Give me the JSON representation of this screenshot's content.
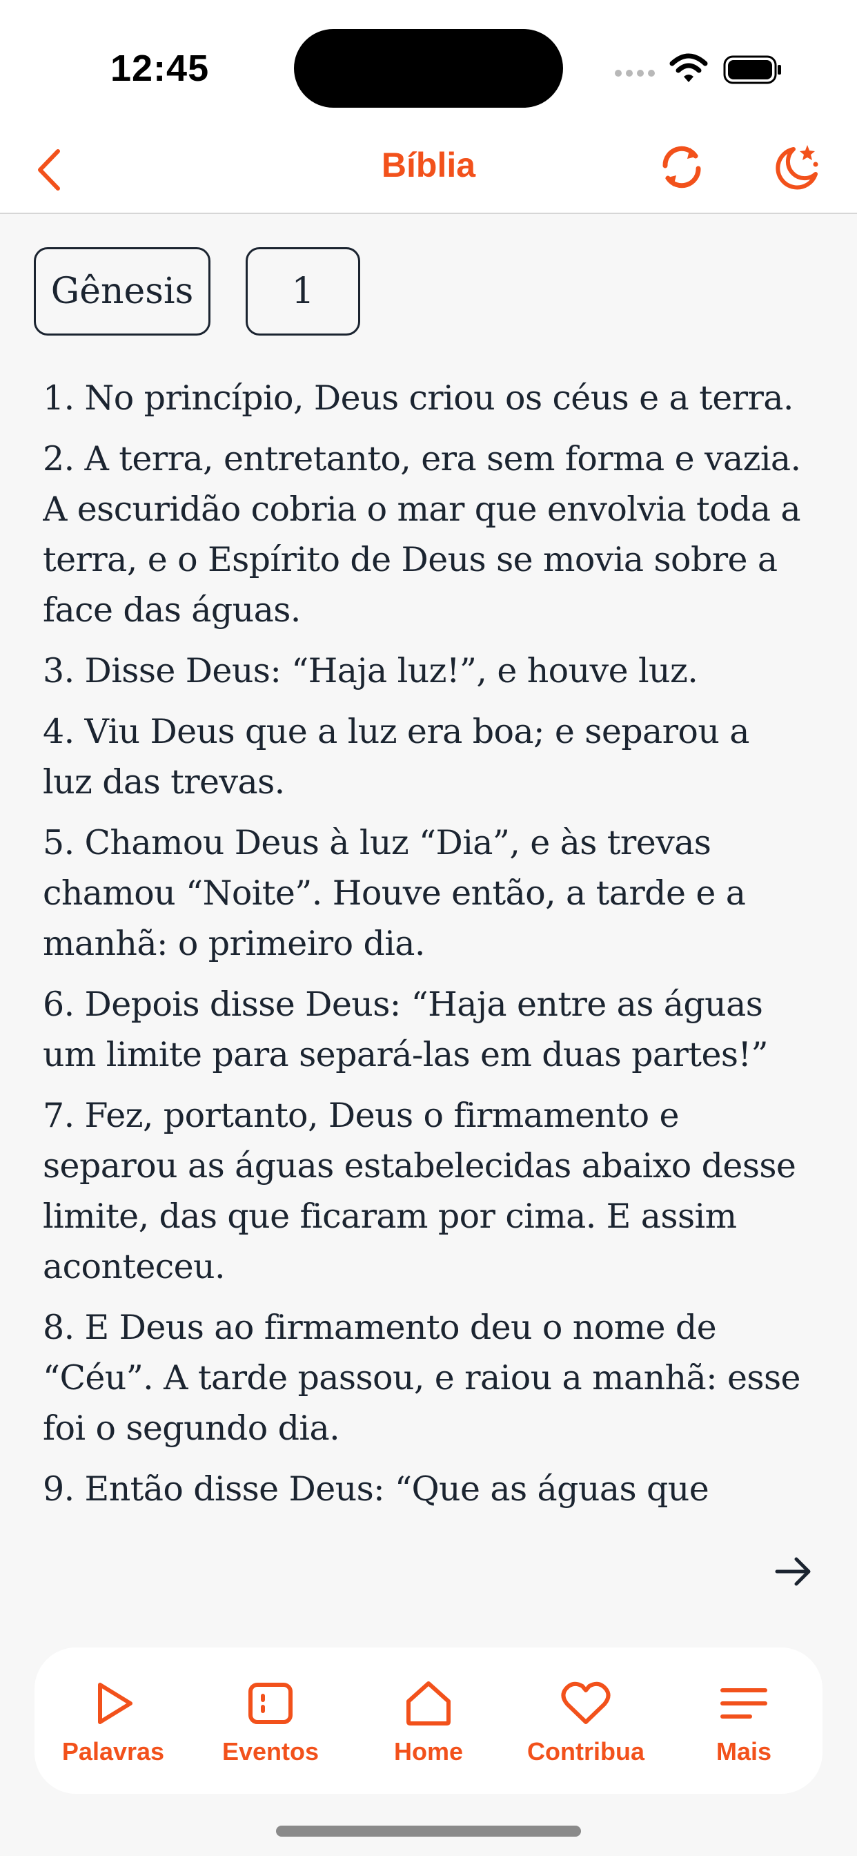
{
  "status_bar": {
    "time": "12:45"
  },
  "nav": {
    "title": "Bíblia"
  },
  "selectors": {
    "book": "Gênesis",
    "chapter": "1"
  },
  "verses": [
    {
      "text": "1. No princípio, Deus criou os céus e a terra."
    },
    {
      "text": "2. A terra, entretanto, era sem forma e vazia. A escuridão cobria o mar que envolvia toda a terra, e o Espírito de Deus se movia sobre a face das águas."
    },
    {
      "text": "3. Disse Deus: “Haja luz!”, e houve luz."
    },
    {
      "text": "4. Viu Deus que a luz era boa; e separou a luz das trevas."
    },
    {
      "text": "5. Chamou Deus à luz “Dia”, e às trevas chamou “Noite”. Houve então, a tarde e a manhã: o primeiro dia."
    },
    {
      "text": "6. Depois disse Deus: “Haja entre as águas um limite para separá-las em duas partes!”"
    },
    {
      "text": "7. Fez, portanto, Deus o firmamento e separou as águas estabelecidas abaixo desse limite, das que ficaram por cima. E assim aconteceu."
    },
    {
      "text": "8. E Deus ao firmamento deu o nome de “Céu”. A tarde passou, e raiou a manhã: esse foi o segundo dia."
    },
    {
      "text": "9. Então disse Deus: “Que as águas que"
    }
  ],
  "tabs": [
    {
      "label": "Palavras",
      "icon": "play-icon"
    },
    {
      "label": "Eventos",
      "icon": "events-icon"
    },
    {
      "label": "Home",
      "icon": "home-icon"
    },
    {
      "label": "Contribua",
      "icon": "heart-icon"
    },
    {
      "label": "Mais",
      "icon": "menu-icon"
    }
  ],
  "colors": {
    "accent": "#f2511b",
    "text": "#1b2430",
    "background": "#f7f7f7"
  }
}
